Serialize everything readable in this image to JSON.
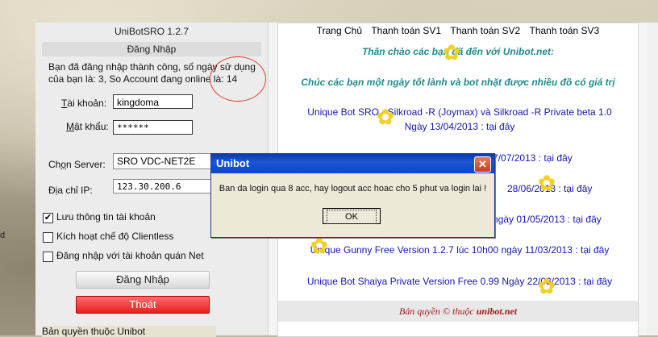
{
  "background": {
    "fragment": "d"
  },
  "app": {
    "title": "UniBotSRO 1.2.7",
    "login_header": "Đăng Nhập",
    "login_message_line1": "Bạn đã đăng nhập thành công, số ngày sử dụng",
    "login_message_line2": "của bạn là: 3, So Account đang online là: 14",
    "username_label_u": "T",
    "username_label_rest": "ài khoản:",
    "username_value": "kingdoma",
    "password_label_u": "M",
    "password_label_rest": "ật khẩu:",
    "password_value": "******",
    "server_label_pre": "Ch",
    "server_label_u": "ọ",
    "server_label_rest": "n Server:",
    "server_value": "SRO VDC-NET2E",
    "ip_label_pre": "Đ",
    "ip_label_u": "ị",
    "ip_label_rest": "a chỉ IP:",
    "ip_value": "123.30.200.6",
    "checkboxes": [
      {
        "label": "Lưu thông tin tài khoản",
        "checked": "✔"
      },
      {
        "label": "Kích hoạt chế độ Clientless",
        "checked": ""
      },
      {
        "label": "Đăng nhập với tài khoản quán Net",
        "checked": ""
      }
    ],
    "login_button": "Đăng Nhập",
    "exit_button": "Thoát",
    "copyright": "Bản quyền thuộc Unibot"
  },
  "web": {
    "nav": [
      "Trang Chủ",
      "Thanh toán SV1",
      "Thanh toán SV2",
      "Thanh toán SV3"
    ],
    "greeting": "Thân chào các bạn đã đến với Unibot.net:",
    "wish": "Chúc các bạn một ngày tốt lành và bot nhặt được nhiều đồ có giá trị",
    "news": [
      "Unique Bot SRO - Silkroad -R (Joymax) và Silkroad -R Private beta 1.0",
      "Ngày 13/04/2013 : tại đây",
      "ngày 07/07/2013 : tại đây",
      "28/06/2013 : tại đây",
      "ngày 01/05/2013 : tại đây",
      "Unique Gunny Free Version 1.2.7 lúc 10h00 ngày 11/03/2013 : tại đây",
      "Unique Bot Shaiya Private Version Free 0.99 Ngày 22/03/2013 : tại đây"
    ],
    "footer_text": "Bản quyền © thuộc",
    "footer_brand": "unibot.net"
  },
  "dialog": {
    "title": "Unibot",
    "close": "✕",
    "message": "Ban da login qua 8 acc, hay logout acc hoac cho 5 phut va login lai !",
    "ok": "OK"
  },
  "colors": {
    "titlebar": "#0d47c8",
    "greeting": "#1e8c8c",
    "link": "#1515b8",
    "exit_button": "#e82020",
    "circle": "#e23b2e"
  },
  "icons": {
    "flower": "flower-icon"
  }
}
